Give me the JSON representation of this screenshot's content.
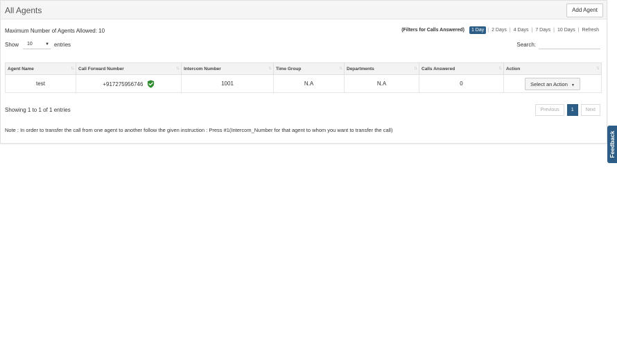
{
  "header": {
    "title": "All Agents",
    "add_agent_label": "Add Agent"
  },
  "max_agents_text": "Maximum Number of Agents Allowed: 10",
  "filters": {
    "label": "(Filters for Calls Answered)",
    "options": [
      "1 Day",
      "2 Days",
      "4 Days",
      "7 Days",
      "10 Days",
      "Refresh"
    ],
    "active": "1 Day"
  },
  "length_control": {
    "prefix": "Show",
    "value": "10",
    "suffix": "entries"
  },
  "search": {
    "label": "Search:",
    "value": ""
  },
  "table": {
    "columns": [
      "Agent Name",
      "Call Forward Number",
      "Intercom Number",
      "Time Group",
      "Departments",
      "Calls Answered",
      "Action"
    ],
    "rows": [
      {
        "agent_name": "test",
        "call_forward_number": "+917275956746",
        "intercom_number": "1001",
        "time_group": "N.A",
        "departments": "N.A",
        "calls_answered": "0",
        "action_label": "Select an Action"
      }
    ]
  },
  "info_text": "Showing 1 to 1 of 1 entries",
  "pagination": {
    "previous": "Previous",
    "current": "1",
    "next": "Next"
  },
  "note": "Note : In order to transfer the call from one agent to another follow the given instruction : Press #1(Intercom_Number for that agent to whom you want to transfer the call)",
  "feedback_label": "Feedback",
  "colors": {
    "accent": "#2b5d86",
    "verified": "#2e8b2e"
  },
  "icons": {
    "verified": "shield-check-icon",
    "sort": "sort-arrows-icon",
    "dropdown": "caret-down-icon"
  }
}
